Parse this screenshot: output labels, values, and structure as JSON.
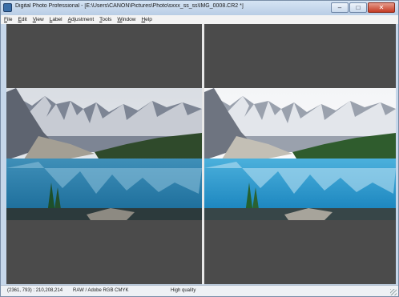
{
  "window": {
    "title": "Digital Photo Professional - [E:\\Users\\CANON\\Pictures\\Photo\\sxxx_ss_ss\\IMG_0008.CR2 *]",
    "controls": {
      "minimize": "–",
      "maximize": "□",
      "close": "✕"
    }
  },
  "menu": [
    "File",
    "Edit",
    "View",
    "Label",
    "Adjustment",
    "Tools",
    "Window",
    "Help"
  ],
  "viewer": {
    "left_pane": {
      "image": "landscape-before"
    },
    "right_pane": {
      "image": "landscape-after"
    }
  },
  "status": {
    "coords": "(2361, 793) : 210,208,214",
    "color_info": "RAW / Adobe RGB  CMYK",
    "quality": "High quality"
  }
}
